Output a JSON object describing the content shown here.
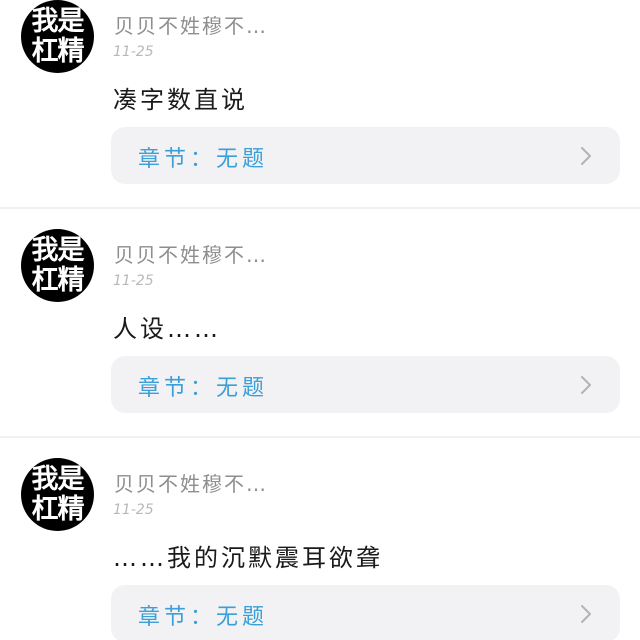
{
  "comments": [
    {
      "avatar": {
        "line1": "我是",
        "line2": "杠精"
      },
      "username": "贝贝不姓穆不…",
      "date": "11-25",
      "text": "凑字数直说",
      "chapter_label": "章节：无题"
    },
    {
      "avatar": {
        "line1": "我是",
        "line2": "杠精"
      },
      "username": "贝贝不姓穆不…",
      "date": "11-25",
      "text": "人设……",
      "chapter_label": "章节：无题"
    },
    {
      "avatar": {
        "line1": "我是",
        "line2": "杠精"
      },
      "username": "贝贝不姓穆不…",
      "date": "11-25",
      "text": "……我的沉默震耳欲聋",
      "chapter_label": "章节：无题"
    }
  ],
  "icons": {
    "chapter_link": "chevron-right-icon"
  },
  "colors": {
    "chapter_text": "#3b9fd8",
    "card_bg": "#f2f2f4",
    "avatar_bg": "#000000"
  }
}
